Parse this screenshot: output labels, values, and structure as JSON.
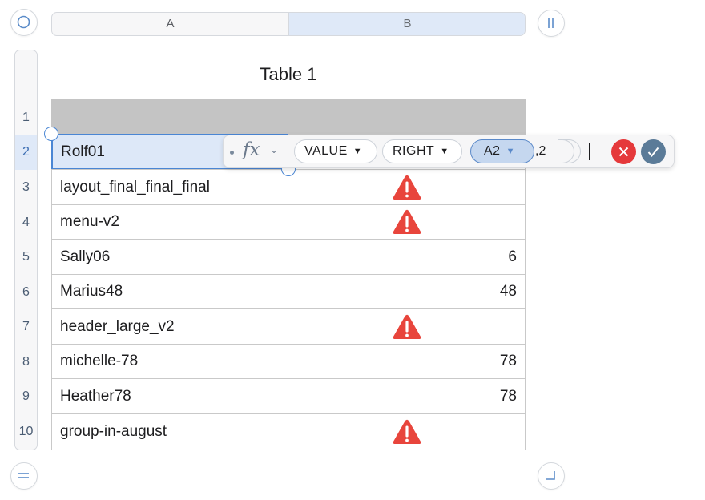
{
  "columns": [
    "A",
    "B"
  ],
  "rows": [
    "1",
    "2",
    "3",
    "4",
    "5",
    "6",
    "7",
    "8",
    "9",
    "10"
  ],
  "table_title": "Table 1",
  "cells": [
    {
      "a": "",
      "b": ""
    },
    {
      "a": "Rolf01",
      "b": ""
    },
    {
      "a": "layout_final_final_final",
      "b": "warning"
    },
    {
      "a": "menu-v2",
      "b": "warning"
    },
    {
      "a": "Sally06",
      "b": "6"
    },
    {
      "a": "Marius48",
      "b": "48"
    },
    {
      "a": "header_large_v2",
      "b": "warning"
    },
    {
      "a": "michelle-78",
      "b": "78"
    },
    {
      "a": "Heather78",
      "b": "78"
    },
    {
      "a": "group-in-august",
      "b": "warning"
    }
  ],
  "formula": {
    "fx_label": "fx",
    "fn_value": "VALUE",
    "fn_right": "RIGHT",
    "ref": "A2",
    "argument": ",2"
  },
  "colors": {
    "selection": "#4a86d4",
    "warning": "#e8453c",
    "cancel": "#e5393b",
    "accept": "#5b7b98"
  }
}
